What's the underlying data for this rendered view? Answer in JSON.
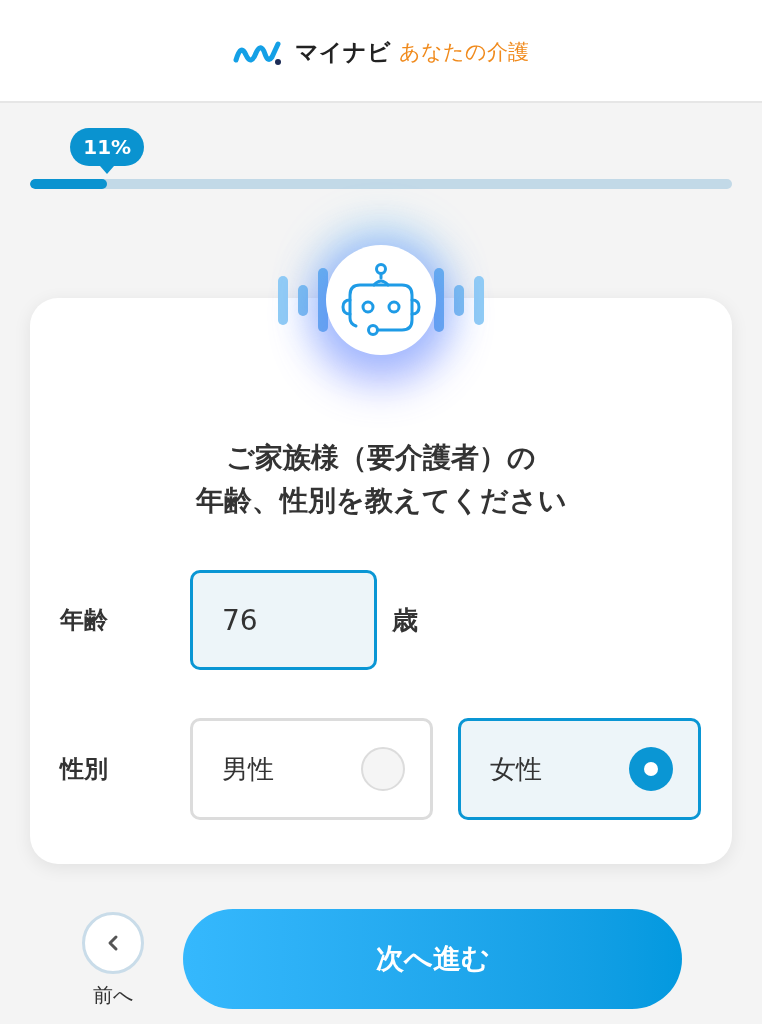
{
  "header": {
    "logo": {
      "brand": "マイナビ",
      "service": "あなたの介護"
    }
  },
  "progress": {
    "label": "11%",
    "level": 0.11
  },
  "question": {
    "title_lines": [
      "ご家族様（要介護者）の",
      "年齢、性別を教えてください"
    ]
  },
  "fields": [
    {
      "kind": "number",
      "label": "年齢",
      "value": "76",
      "unit": "歳"
    },
    {
      "kind": "radio",
      "label": "性別",
      "options": [
        {
          "label": "男性",
          "selected": false
        },
        {
          "label": "女性",
          "selected": true
        }
      ]
    }
  ],
  "navigation": {
    "back": {
      "label": "前へ"
    },
    "next": {
      "label": "次へ進む"
    }
  }
}
